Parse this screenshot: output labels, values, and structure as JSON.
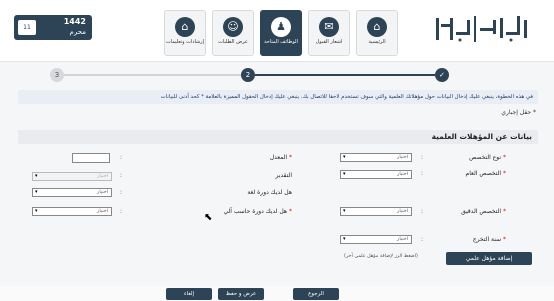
{
  "header": {
    "year": "1442",
    "month": "محرم",
    "box_value": "11",
    "nav": [
      {
        "label": "الرئيسية",
        "icon": "home-icon"
      },
      {
        "label": "اشعار القبول",
        "icon": "certificate-icon"
      },
      {
        "label": "الوظائف المتاحة",
        "icon": "users-icon"
      },
      {
        "label": "عرض الطلبات",
        "icon": "user-icon"
      },
      {
        "label": "إرشادات وتعليمات",
        "icon": "home-icon"
      }
    ],
    "logo_text": "أبشر توظيف"
  },
  "stepper": {
    "steps": [
      "✓",
      "2",
      "3"
    ]
  },
  "info_text": "في هذه الخطوة، ينبغي عليك إدخال البيانات حول مؤهلاتك العلمية والتي سوف تستخدم لاحقا للاتصال بك. ينبغي عليك إدخال الحقول المميزة بالعلامة * كحد أدنى للبيانات",
  "required_note": "* حقل إجباري",
  "section_title": "بيانات عن المؤهلات العلمية",
  "form": {
    "specialization_type_label": "نوع التخصص",
    "general_specialization_label": "التخصص العام",
    "precise_specialization_label": "التخصص الدقيق",
    "graduation_year_label": "سنة التخرج",
    "gpa_label": "المعدل",
    "grade_label": "التقدير",
    "language_course_label": "هل لديك دورة لغة",
    "computer_course_label": "هل لديك دورة حاسب آلي",
    "select_placeholder": "اختيار"
  },
  "add_button": "إضافة مؤهل علمي",
  "add_note": "(اضغط الزر لإضافة مؤهل علمي آخر)",
  "footer": {
    "back": "الرجوع",
    "save": "عرض و حفظ",
    "cancel": "إلغاء"
  }
}
